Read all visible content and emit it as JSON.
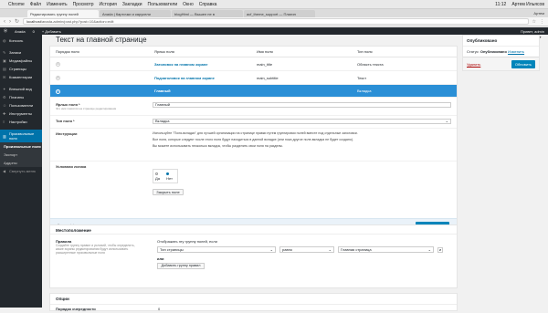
{
  "macbar": {
    "menus": [
      "Chrome",
      "Файл",
      "Изменить",
      "Просмотр",
      "История",
      "Закладки",
      "Пользователи",
      "Окно",
      "Справка"
    ],
    "time": "11:12",
    "user": "Артем Ильясов"
  },
  "tabs": [
    {
      "title": "Редактировать группу полей",
      "active": true
    },
    {
      "title": "Anada | Карточки и карусели",
      "active": false
    },
    {
      "title": "blogHtml — Вышел не в",
      "active": false
    },
    {
      "title": "acf_theme_support — Плагин",
      "active": false
    }
  ],
  "tab_user": "Артем",
  "url": {
    "host": "localhost",
    "path": "/anada-admin/post.php?post=10&action=edit"
  },
  "adminbar": {
    "site": "Anada",
    "comments": "0",
    "new": "+ Добавить",
    "greeting": "Привет, admin"
  },
  "sidebar": {
    "items": [
      {
        "icon": "◍",
        "label": "Консоль"
      },
      {
        "icon": "✎",
        "label": "Записи"
      },
      {
        "icon": "▣",
        "label": "Медиафайлы"
      },
      {
        "icon": "▤",
        "label": "Страницы"
      },
      {
        "icon": "✉",
        "label": "Комментарии"
      },
      {
        "icon": "✦",
        "label": "Внешний вид"
      },
      {
        "icon": "⚙",
        "label": "Плагины"
      },
      {
        "icon": "☺",
        "label": "Пользователи"
      },
      {
        "icon": "✚",
        "label": "Инструменты"
      },
      {
        "icon": "≡",
        "label": "Настройки"
      },
      {
        "icon": "▥",
        "label": "Произвольные поля"
      }
    ],
    "sub": [
      "Произвольные поля",
      "Экспорт",
      "Аддоны"
    ],
    "collapse": "Свернуть меню"
  },
  "screen_options": "Настройки экрана ▾",
  "page": {
    "title": "Текст на главной странице",
    "columns": [
      "Порядок поля",
      "Ярлык поля",
      "Имя поля",
      "Тип поля"
    ],
    "fields": [
      {
        "num": "1",
        "label": "Заголовок на главном экране",
        "name": "main_title",
        "type": "Область текста"
      },
      {
        "num": "2",
        "label": "Подзаголовок на главном экране",
        "name": "main_subtitle",
        "type": "Текст"
      },
      {
        "num": "3",
        "label": "Главный",
        "name": "",
        "type": "Вкладка"
      }
    ],
    "edit": {
      "label_title": "Ярлык поля *",
      "label_hint": "Это имя появится на странице редактирования",
      "label_value": "Главный",
      "type_title": "Тип поля *",
      "type_value": "Вкладка",
      "instr_title": "Инструкции",
      "instr_p1": "Используйте \"Поля-вкладки\" для лучшей организации на странице правки путем группировки полей вместе под отдельные заголовки.",
      "instr_p2": "Все поля, которые следуют после этого поля будут находиться в данной вкладке (или пока другое поле-вкладка не будет создано).",
      "instr_p3": "Вы можете использовать несколько вкладок, чтобы разделить свои поля на разделы.",
      "logic_title": "Условная логика",
      "logic_yes": "Да",
      "logic_no": "Нет",
      "close_btn": "Закрыть поле"
    },
    "footer": {
      "hint": "Drag and drop для изменения порядка",
      "add": "+ Добавить поле"
    }
  },
  "location": {
    "title": "Местоположение",
    "rules_title": "Правила",
    "rules_hint": "Создайте группу правил и условий, чтобы определить, какие экраны редактирования будут использовать расширенные произвольные поля",
    "show_if": "Отображать эту группу полей, если",
    "param": "Тип страницы",
    "operator": "равно",
    "value": "Главная страница",
    "and": "и",
    "or": "или",
    "add_group": "Добавить группу правил"
  },
  "options": {
    "title": "Опции",
    "row1": "Порядок очередности",
    "row1_value": "0"
  },
  "publish": {
    "title": "Опубликовано",
    "status_label": "Статус:",
    "status": "Опубликовано",
    "edit_link": "Изменить",
    "delete": "Удалить",
    "update": "Обновить"
  }
}
